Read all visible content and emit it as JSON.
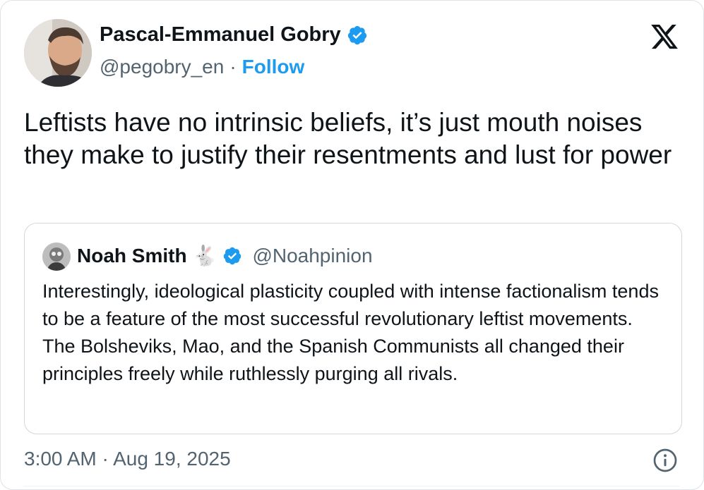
{
  "author": {
    "name": "Pascal-Emmanuel Gobry",
    "handle": "@pegobry_en",
    "separator": "·",
    "follow_label": "Follow",
    "verified_color": "#1d9bf0"
  },
  "tweet": {
    "text": "Leftists have no intrinsic beliefs, it’s just mouth noises they make to justify their resentments and lust for power"
  },
  "quoted_tweet": {
    "author_name": "Noah Smith",
    "emoji": "🐇",
    "handle": "@Noahpinion",
    "text": "Interestingly, ideological plasticity coupled with intense factionalism tends to be a feature of the most successful revolutionary leftist movements. The Bolsheviks, Mao, and the Spanish Communists all changed their principles freely while ruthlessly purging all rivals."
  },
  "footer": {
    "timestamp": "3:00 AM · Aug 19, 2025"
  },
  "icons": {
    "brand": "x-logo-icon",
    "verified": "verified-badge-icon",
    "info": "info-icon"
  },
  "colors": {
    "link": "#1d9bf0",
    "secondary_text": "#536471",
    "primary_text": "#0f1419",
    "border": "#cfd9de"
  }
}
